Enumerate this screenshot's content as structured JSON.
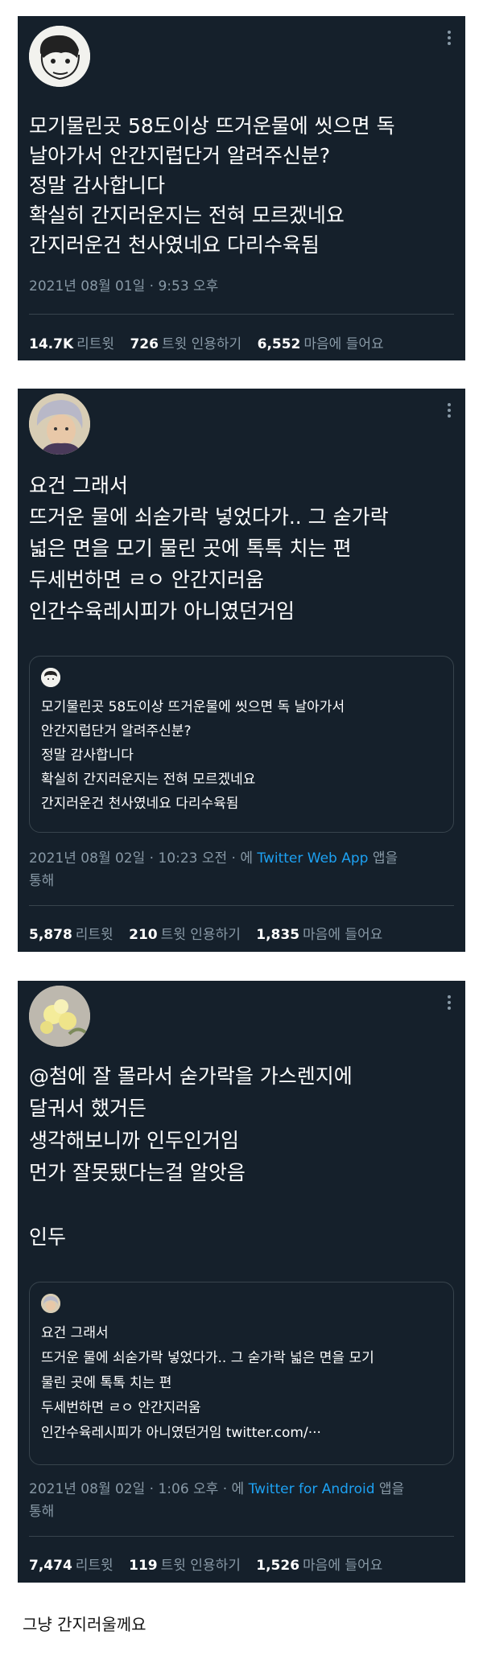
{
  "tweets": [
    {
      "lines": [
        "모기물린곳 58도이상 뜨거운물에 씻으면 독",
        "날아가서 안간지럽단거 알려주신분?",
        "정말 감사합니다",
        "확실히 간지러운지는 전혀 모르겠네요",
        "간지러운건 천사였네요 다리수육됨"
      ],
      "meta": "2021년 08월 01일 · 9:53 오후",
      "stats": [
        {
          "num": "14.7K",
          "label": "리트윗"
        },
        {
          "num": "726",
          "label": "트윗 인용하기"
        },
        {
          "num": "6,552",
          "label": "마음에 들어요"
        }
      ]
    },
    {
      "lines": [
        "요건 그래서",
        "뜨거운 물에 쇠숟가락 넣었다가.. 그 숟가락",
        "넓은 면을 모기 물린 곳에 톡톡 치는 편",
        "두세번하면 ㄹㅇ 안간지러움",
        "인간수육레시피가 아니였던거임"
      ],
      "quote_lines": [
        "모기물린곳 58도이상 뜨거운물에 씻으면 독 날아가서",
        "안간지럽단거 알려주신분?",
        "정말 감사합니다",
        "확실히 간지러운지는 전혀 모르겠네요",
        "간지러운건 천사였네요 다리수육됨"
      ],
      "meta_prefix": "2021년 08월 02일 · 10:23 오전 · 에 ",
      "meta_app": "Twitter Web App",
      "meta_suffix": " 앱을",
      "meta_line2": "통해",
      "stats": [
        {
          "num": "5,878",
          "label": "리트윗"
        },
        {
          "num": "210",
          "label": "트윗 인용하기"
        },
        {
          "num": "1,835",
          "label": "마음에 들어요"
        }
      ]
    },
    {
      "lines": [
        "@첨에 잘 몰라서 숟가락을 가스렌지에",
        "달궈서 했거든",
        "생각해보니까 인두인거임",
        "먼가 잘못됐다는걸 알앗음",
        "",
        "인두"
      ],
      "quote_lines": [
        "요건 그래서",
        "뜨거운 물에 쇠숟가락 넣었다가.. 그 숟가락 넓은 면을 모기",
        "물린 곳에 톡톡 치는 편",
        "두세번하면 ㄹㅇ 안간지러움",
        "인간수육레시피가 아니였던거임 twitter.com/···"
      ],
      "meta_prefix": "2021년 08월 02일 · 1:06 오후 · 에 ",
      "meta_app": "Twitter for Android",
      "meta_suffix": " 앱을",
      "meta_line2": "통해",
      "stats": [
        {
          "num": "7,474",
          "label": "리트윗"
        },
        {
          "num": "119",
          "label": "트윗 인용하기"
        },
        {
          "num": "1,526",
          "label": "마음에 들어요"
        }
      ]
    }
  ],
  "caption": "그냥 간지러울께요"
}
